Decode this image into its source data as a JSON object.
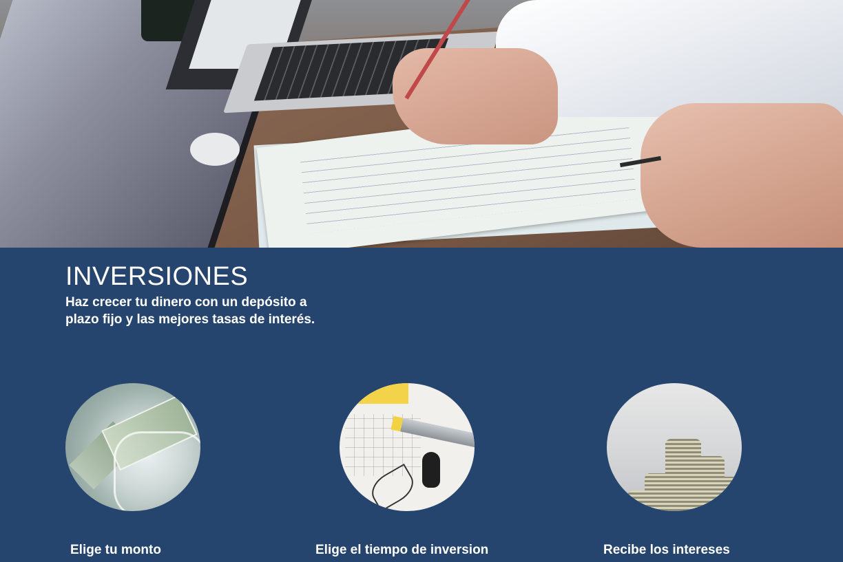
{
  "hero": {
    "image_alt": "Business people planning with pencil and papers on a desk"
  },
  "main": {
    "title": "INVERSIONES",
    "subtitle": "Haz crecer tu dinero con un depósito a plazo fijo y las mejores tasas de interés."
  },
  "steps": [
    {
      "label": "Elige tu monto",
      "image": "money-jar-image"
    },
    {
      "label": "Elige el tiempo de inversion",
      "image": "calendar-image"
    },
    {
      "label": "Recibe los intereses",
      "image": "coin-stacks-image"
    }
  ],
  "colors": {
    "background": "#26456e",
    "text": "#ffffff"
  }
}
